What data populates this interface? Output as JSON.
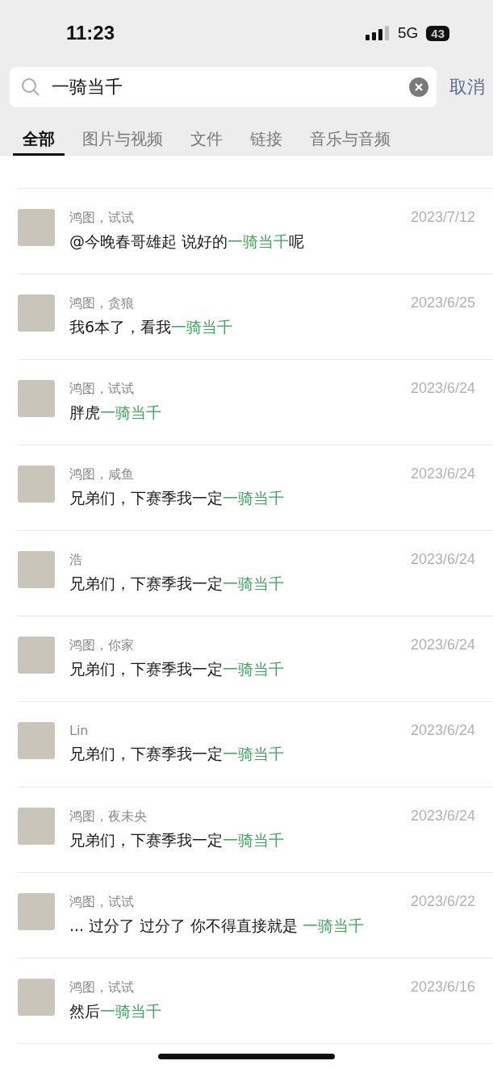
{
  "status_bar": {
    "time": "11:23",
    "network": "5G",
    "battery": "43"
  },
  "search": {
    "value": "一骑当千",
    "cancel": "取消"
  },
  "tabs": [
    {
      "label": "全部",
      "selected": true
    },
    {
      "label": "图片与视频",
      "selected": false
    },
    {
      "label": "文件",
      "selected": false
    },
    {
      "label": "链接",
      "selected": false
    },
    {
      "label": "音乐与音频",
      "selected": false
    }
  ],
  "results": [
    {
      "sender": "鸿图，试试",
      "date": "2023/7/12",
      "before": "@今晚春哥雄起 说好的",
      "match": "一骑当千",
      "after": "呢"
    },
    {
      "sender": "鸿图，贪狼",
      "date": "2023/6/25",
      "before": "我6本了，看我",
      "match": "一骑当千"
    },
    {
      "sender": "鸿图，试试",
      "date": "2023/6/24",
      "before": "胖虎",
      "match": "一骑当千"
    },
    {
      "sender": "鸿图，咸鱼",
      "date": "2023/6/24",
      "before": "兄弟们，下赛季我一定",
      "match": "一骑当千"
    },
    {
      "sender": "浩",
      "date": "2023/6/24",
      "before": "兄弟们，下赛季我一定",
      "match": "一骑当千"
    },
    {
      "sender": "鸿图，你家",
      "date": "2023/6/24",
      "before": "兄弟们，下赛季我一定",
      "match": "一骑当千"
    },
    {
      "sender": "Lin",
      "date": "2023/6/24",
      "before": "兄弟们，下赛季我一定",
      "match": "一骑当千"
    },
    {
      "sender": "鸿图，夜未央",
      "date": "2023/6/24",
      "before": "兄弟们，下赛季我一定",
      "match": "一骑当千"
    },
    {
      "sender": "鸿图，试试",
      "date": "2023/6/22",
      "before": "... 过分了 过分了 你不得直接就是 ",
      "match": "一骑当千"
    },
    {
      "sender": "鸿图，试试",
      "date": "2023/6/16",
      "before": "然后",
      "match": "一骑当千"
    }
  ]
}
